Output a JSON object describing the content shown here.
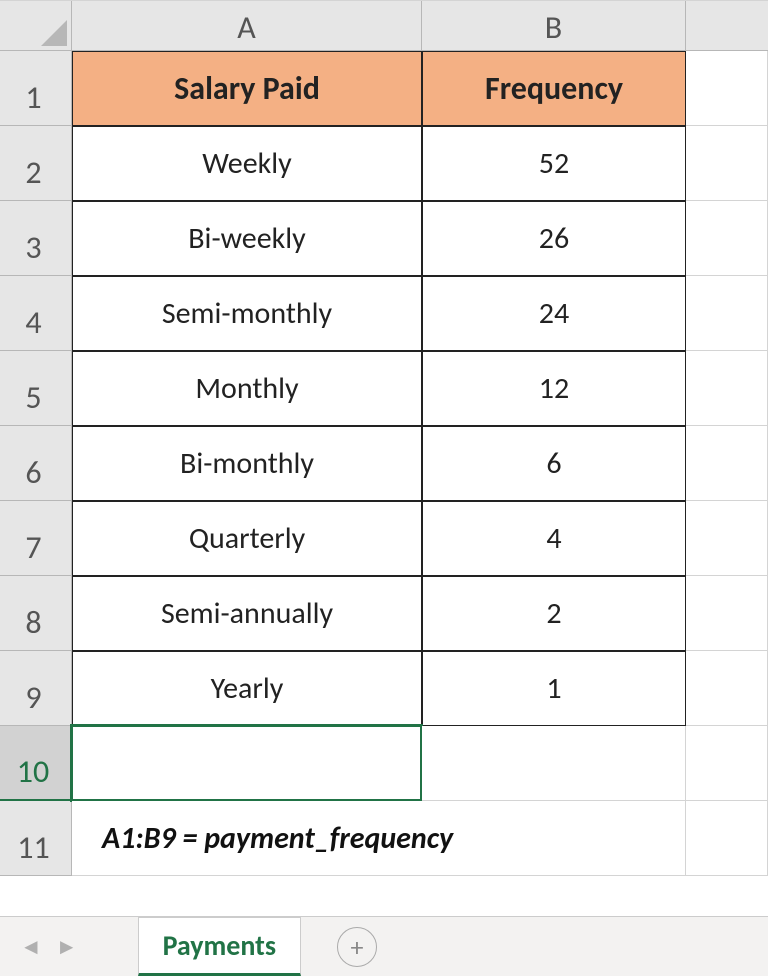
{
  "columns": [
    "A",
    "B"
  ],
  "rows_labels": [
    "1",
    "2",
    "3",
    "4",
    "5",
    "6",
    "7",
    "8",
    "9",
    "10",
    "11"
  ],
  "header": {
    "colA": "Salary Paid",
    "colB": "Frequency"
  },
  "rows": [
    {
      "a": "Weekly",
      "b": "52"
    },
    {
      "a": "Bi-weekly",
      "b": "26"
    },
    {
      "a": "Semi-monthly",
      "b": "24"
    },
    {
      "a": "Monthly",
      "b": "12"
    },
    {
      "a": "Bi-monthly",
      "b": "6"
    },
    {
      "a": "Quarterly",
      "b": "4"
    },
    {
      "a": "Semi-annually",
      "b": "2"
    },
    {
      "a": "Yearly",
      "b": "1"
    }
  ],
  "note": "A1:B9 = payment_frequency",
  "tab": {
    "active": "Payments"
  },
  "watermark": {
    "main": "",
    "sub": ""
  }
}
